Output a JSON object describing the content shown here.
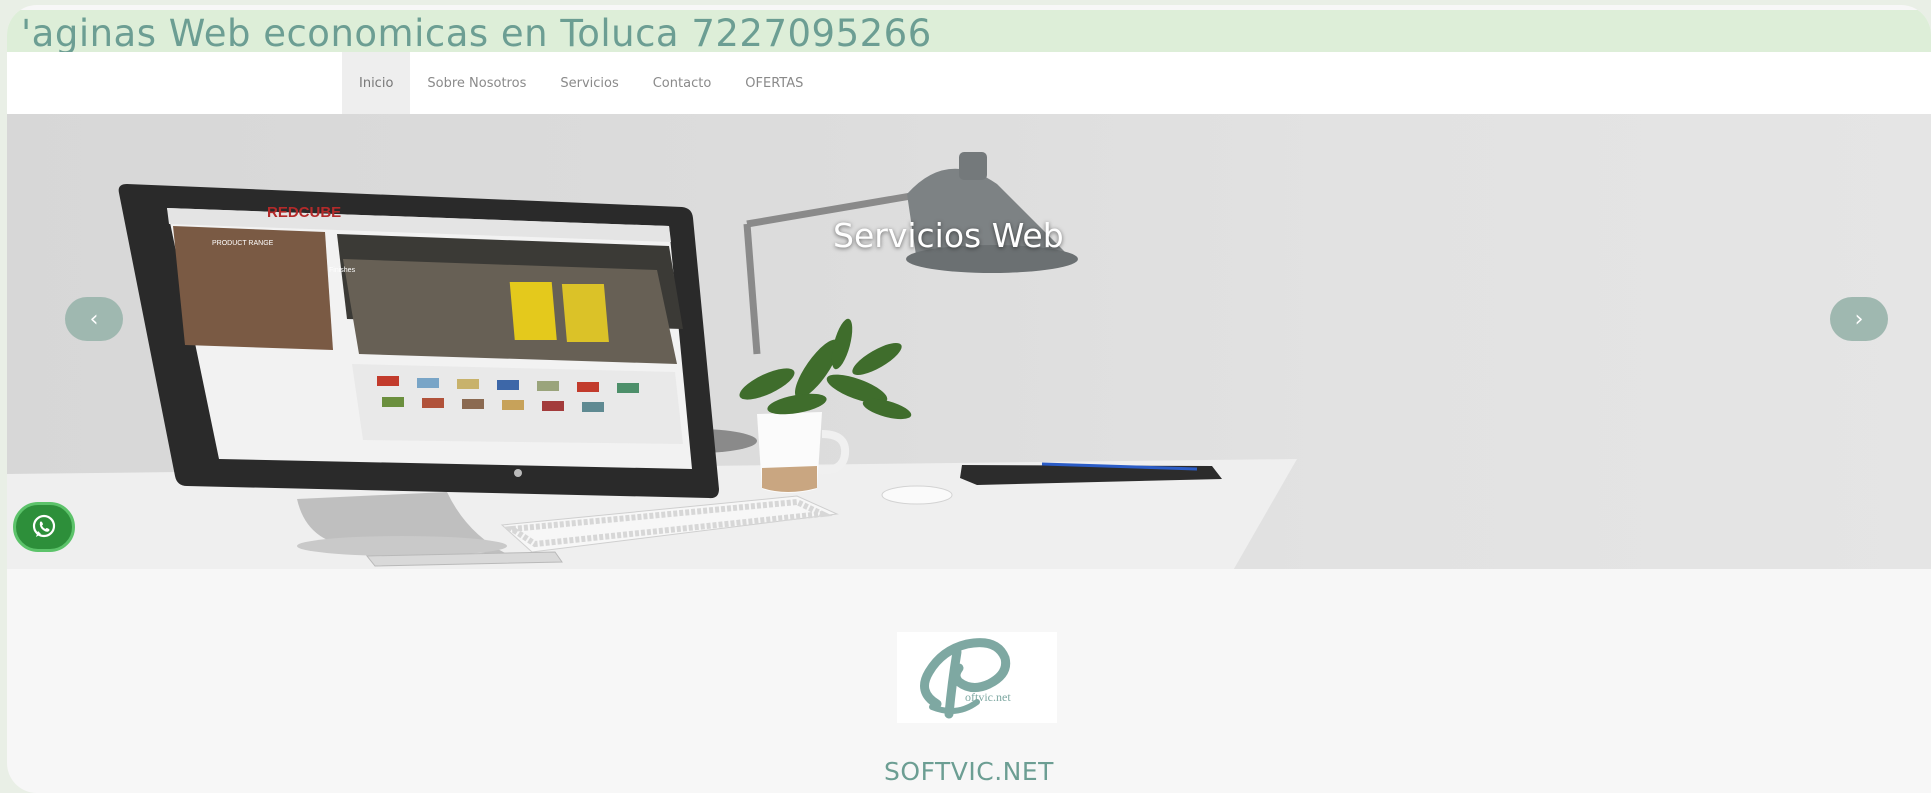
{
  "marquee": {
    "text": "'aginas Web economicas en Toluca 7227095266"
  },
  "nav": {
    "items": [
      "Inicio",
      "Sobre Nosotros",
      "Servicios",
      "Contacto",
      "OFERTAS"
    ],
    "active": "Inicio"
  },
  "hero": {
    "caption": "Servicios Web",
    "prev_icon": "‹",
    "next_icon": "›",
    "screen": {
      "logo": "REDCUBE",
      "sidebar_title": "PRODUCT RANGE",
      "content_title": "Finishes"
    }
  },
  "whatsapp": {
    "icon": "whatsapp-icon"
  },
  "logo": {
    "text": "oftvic.net"
  },
  "brand": {
    "name": "SOFTVIC.NET"
  },
  "colors": {
    "accent": "#6c9e93",
    "marquee_bg": "#ddeed8",
    "whatsapp": "#2d8f3a"
  }
}
